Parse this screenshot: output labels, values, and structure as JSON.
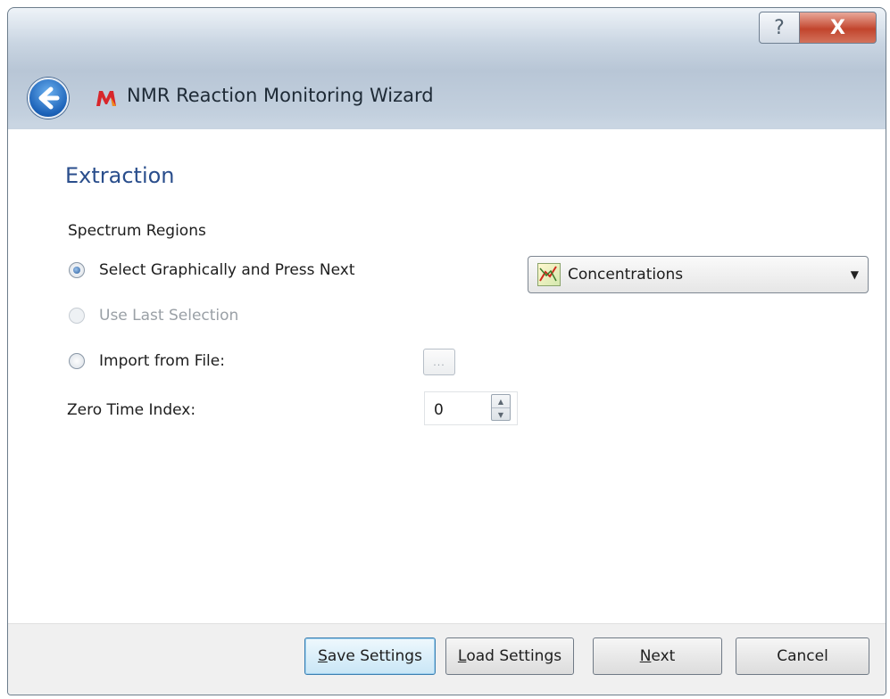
{
  "window": {
    "title": "NMR Reaction Monitoring Wizard",
    "help_glyph": "?",
    "close_glyph": "X"
  },
  "page": {
    "heading": "Extraction",
    "section_label": "Spectrum Regions",
    "options": [
      {
        "label": "Select Graphically and Press Next",
        "selected": true,
        "enabled": true
      },
      {
        "label": "Use Last Selection",
        "selected": false,
        "enabled": false
      },
      {
        "label": "Import from File:",
        "selected": false,
        "enabled": true
      }
    ],
    "browse_label": "...",
    "output_dropdown": {
      "selected": "Concentrations"
    },
    "zero_time": {
      "label": "Zero Time Index:",
      "value": "0"
    }
  },
  "footer": {
    "save": {
      "mnemonic": "S",
      "rest": "ave Settings"
    },
    "load": {
      "mnemonic": "L",
      "rest": "oad Settings"
    },
    "next": {
      "mnemonic": "N",
      "rest": "ext"
    },
    "cancel": "Cancel"
  },
  "colors": {
    "heading": "#2a4e8c",
    "close_button": "#c2452d",
    "default_button_border": "#3c7fb1"
  },
  "icons": [
    "help-icon",
    "close-icon",
    "back-arrow-icon",
    "app-logo-icon",
    "chart-icon",
    "dropdown-caret-icon",
    "spin-up-icon",
    "spin-down-icon"
  ]
}
